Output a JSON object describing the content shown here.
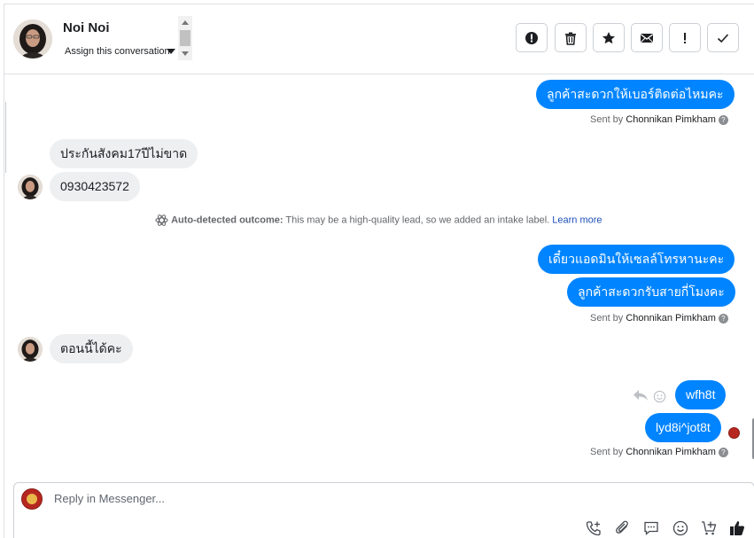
{
  "header": {
    "contact_name": "Noi Noi",
    "assign_label": "Assign this conversation",
    "actions": [
      {
        "name": "spam-button",
        "icon": "alert-circle-icon"
      },
      {
        "name": "delete-button",
        "icon": "trash-icon"
      },
      {
        "name": "star-button",
        "icon": "star-icon"
      },
      {
        "name": "mark-unread-button",
        "icon": "envelope-icon"
      },
      {
        "name": "follow-up-button",
        "icon": "exclamation-icon"
      },
      {
        "name": "mark-done-button",
        "icon": "check-icon"
      }
    ]
  },
  "messages": {
    "m1": "ลูกค้าสะดวกให้เบอร์ติดต่อไหมคะ",
    "sent1_prefix": "Sent by ",
    "sent1_name": "Chonnikan Pimkham",
    "m2": "ประกันสังคม17ปีไม่ขาด",
    "m3": "0930423572",
    "outcome_label": "Auto-detected outcome:",
    "outcome_text": " This may be a high-quality lead, so we added an intake label. ",
    "outcome_link": "Learn more",
    "m4": "เดี๋ยวแอดมินให้เซลล์โทรหานะคะ",
    "m5": "ลูกค้าสะดวกรับสายกี่โมงคะ",
    "sent2_prefix": "Sent by ",
    "sent2_name": "Chonnikan Pimkham",
    "m6": "ตอนนี้ได้คะ",
    "m7": "wfh8t",
    "m8": "lyd8i^jot8t",
    "sent3_prefix": "Sent by ",
    "sent3_name": "Chonnikan Pimkham"
  },
  "composer": {
    "placeholder": "Reply in Messenger..."
  },
  "colors": {
    "outgoing_bubble": "#0084ff",
    "incoming_bubble": "#eeeff1",
    "link": "#1d4fb8"
  }
}
